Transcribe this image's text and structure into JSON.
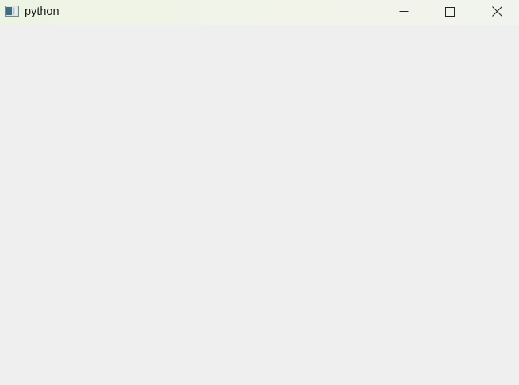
{
  "window": {
    "title": "python",
    "app_icon": "tk-window-icon",
    "controls": [
      {
        "name": "minimize",
        "icon": "minimize-icon"
      },
      {
        "name": "maximize",
        "icon": "maximize-icon"
      },
      {
        "name": "close",
        "icon": "close-icon"
      }
    ]
  },
  "colors": {
    "titlebar": "#eef4e4",
    "client_background": "#efefef",
    "text": "#1a1a1a"
  }
}
